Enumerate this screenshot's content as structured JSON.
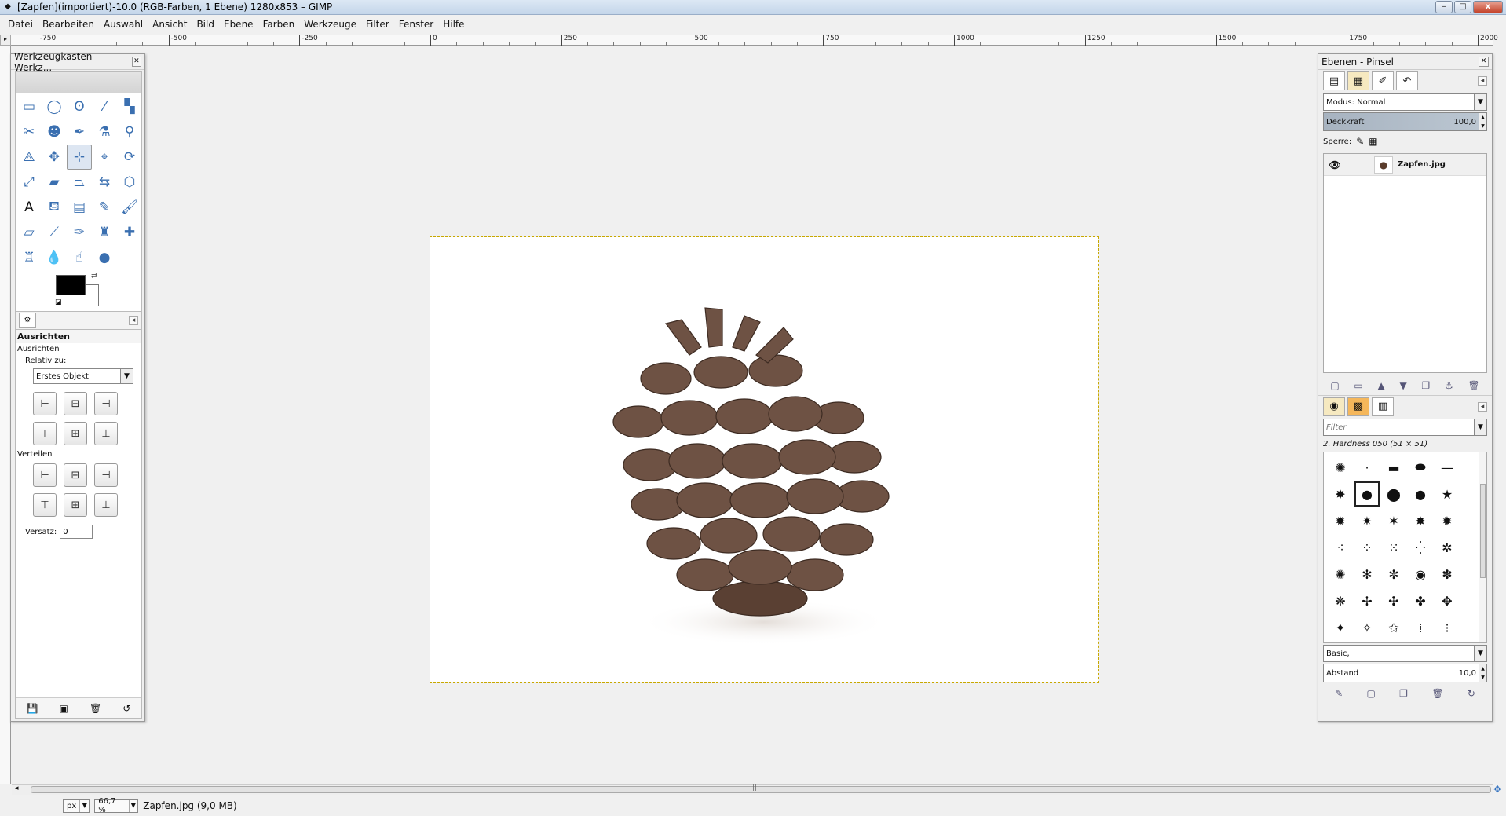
{
  "window": {
    "title": "[Zapfen](importiert)-10.0 (RGB-Farben, 1 Ebene) 1280x853 – GIMP",
    "minimize": "–",
    "maximize": "□",
    "close": "x"
  },
  "menu": [
    "Datei",
    "Bearbeiten",
    "Auswahl",
    "Ansicht",
    "Bild",
    "Ebene",
    "Farben",
    "Werkzeuge",
    "Filter",
    "Fenster",
    "Hilfe"
  ],
  "ruler": {
    "labels": [
      "-750",
      "-500",
      "-250",
      "0",
      "250",
      "500",
      "750",
      "1000",
      "1250",
      "1500",
      "1750",
      "2000"
    ]
  },
  "toolbox": {
    "title": "Werkzeugkasten - Werkz...",
    "tools": [
      {
        "name": "rect-select-icon",
        "glyph": "▭"
      },
      {
        "name": "ellipse-select-icon",
        "glyph": "◯"
      },
      {
        "name": "lasso-icon",
        "glyph": "ʘ"
      },
      {
        "name": "fuzzy-select-icon",
        "glyph": "⁄"
      },
      {
        "name": "color-select-icon",
        "glyph": "▚"
      },
      {
        "name": "scissors-icon",
        "glyph": "✂"
      },
      {
        "name": "foreground-select-icon",
        "glyph": "☻"
      },
      {
        "name": "paths-icon",
        "glyph": "✒"
      },
      {
        "name": "color-picker-icon",
        "glyph": "⚗"
      },
      {
        "name": "zoom-icon",
        "glyph": "⚲"
      },
      {
        "name": "measure-icon",
        "glyph": "⟁"
      },
      {
        "name": "move-icon",
        "glyph": "✥"
      },
      {
        "name": "align-icon",
        "glyph": "⊹"
      },
      {
        "name": "crop-icon",
        "glyph": "⌖"
      },
      {
        "name": "rotate-icon",
        "glyph": "⟳"
      },
      {
        "name": "scale-icon",
        "glyph": "⤢"
      },
      {
        "name": "shear-icon",
        "glyph": "▰"
      },
      {
        "name": "perspective-icon",
        "glyph": "⏢"
      },
      {
        "name": "flip-icon",
        "glyph": "⇆"
      },
      {
        "name": "cage-icon",
        "glyph": "⬡"
      },
      {
        "name": "text-icon",
        "glyph": "A"
      },
      {
        "name": "bucket-fill-icon",
        "glyph": "⛾"
      },
      {
        "name": "blend-icon",
        "glyph": "▤"
      },
      {
        "name": "pencil-icon",
        "glyph": "✎"
      },
      {
        "name": "paintbrush-icon",
        "glyph": "🖌"
      },
      {
        "name": "eraser-icon",
        "glyph": "▱"
      },
      {
        "name": "airbrush-icon",
        "glyph": "⟋"
      },
      {
        "name": "ink-icon",
        "glyph": "✑"
      },
      {
        "name": "clone-icon",
        "glyph": "♜"
      },
      {
        "name": "heal-icon",
        "glyph": "✚"
      },
      {
        "name": "perspective-clone-icon",
        "glyph": "♖"
      },
      {
        "name": "blur-icon",
        "glyph": "💧"
      },
      {
        "name": "smudge-icon",
        "glyph": "☝"
      },
      {
        "name": "dodge-burn-icon",
        "glyph": "●"
      }
    ],
    "active_tool_index": 12,
    "options_title": "Ausrichten",
    "options_sub": "Ausrichten",
    "relative_label": "Relativ zu:",
    "relative_value": "Erstes Objekt",
    "distribute_label": "Verteilen",
    "offset_label": "Versatz:",
    "offset_value": "0",
    "align_buttons": [
      "⊢",
      "⊟",
      "⊣",
      "⊤",
      "⊞",
      "⊥"
    ],
    "distribute_buttons": [
      "⊢",
      "⊟",
      "⊣",
      "⊤",
      "⊞",
      "⊥"
    ]
  },
  "right_dock": {
    "title": "Ebenen - Pinsel",
    "mode_label": "Modus:",
    "mode_value": "Normal",
    "opacity_label": "Deckkraft",
    "opacity_value": "100,0",
    "lock_label": "Sperre:",
    "layers": [
      {
        "name": "Zapfen.jpg"
      }
    ],
    "brush_filter_placeholder": "Filter",
    "brush_name": "2. Hardness 050 (51 × 51)",
    "brush_tag": "Basic,",
    "spacing_label": "Abstand",
    "spacing_value": "10,0",
    "brushes": [
      "✺",
      "·",
      "▬",
      "⬬",
      "—",
      "✸",
      "●",
      "⬤",
      "●",
      "★",
      "✹",
      "✷",
      "✶",
      "✸",
      "✹",
      "⁖",
      "⁘",
      "⁙",
      "⁛",
      "✲",
      "✺",
      "✻",
      "✼",
      "◉",
      "✽",
      "❋",
      "✢",
      "✣",
      "✤",
      "✥",
      "✦",
      "✧",
      "✩",
      "⁞",
      "⁝"
    ]
  },
  "status": {
    "unit": "px",
    "zoom": "66,7 %",
    "text": "Zapfen.jpg (9,0 MB)"
  }
}
